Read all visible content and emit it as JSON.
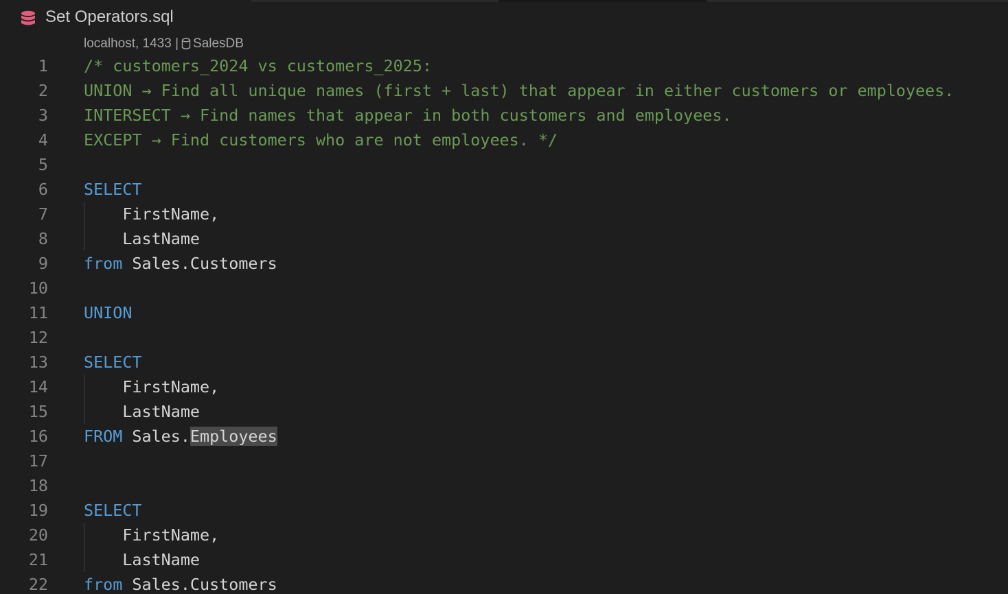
{
  "tab": {
    "title": "Set Operators.sql",
    "icon": "database-icon"
  },
  "connection": {
    "server": "localhost, 1433 |",
    "database": "SalesDB",
    "icon": "database-cylinder-icon"
  },
  "colors": {
    "background": "#1e1e1e",
    "comment": "#6a9955",
    "keyword": "#569cd6",
    "text": "#d4d4d4",
    "line_number": "#858585",
    "selection_highlight": "#4a4a4a",
    "db_icon": "#e05d7c"
  },
  "lines": [
    {
      "n": "1",
      "parts": [
        {
          "t": "/* customers_2024 vs customers_2025:",
          "c": "cmt"
        }
      ]
    },
    {
      "n": "2",
      "parts": [
        {
          "t": "UNION → Find all unique names (first + last) that appear in either customers or employees.",
          "c": "cmt"
        }
      ]
    },
    {
      "n": "3",
      "parts": [
        {
          "t": "INTERSECT → Find names that appear in both customers and employees.",
          "c": "cmt"
        }
      ]
    },
    {
      "n": "4",
      "parts": [
        {
          "t": "EXCEPT → Find customers who are not employees. */",
          "c": "cmt"
        }
      ]
    },
    {
      "n": "5",
      "parts": []
    },
    {
      "n": "6",
      "parts": [
        {
          "t": "SELECT",
          "c": "kw"
        }
      ]
    },
    {
      "n": "7",
      "parts": [
        {
          "t": "    FirstName,",
          "c": "plain"
        }
      ]
    },
    {
      "n": "8",
      "parts": [
        {
          "t": "    LastName",
          "c": "plain"
        }
      ]
    },
    {
      "n": "9",
      "parts": [
        {
          "t": "from",
          "c": "kw"
        },
        {
          "t": " Sales.Customers",
          "c": "plain"
        }
      ]
    },
    {
      "n": "10",
      "parts": []
    },
    {
      "n": "11",
      "parts": [
        {
          "t": "UNION",
          "c": "kw"
        }
      ]
    },
    {
      "n": "12",
      "parts": []
    },
    {
      "n": "13",
      "parts": [
        {
          "t": "SELECT",
          "c": "kw"
        }
      ]
    },
    {
      "n": "14",
      "parts": [
        {
          "t": "    FirstName,",
          "c": "plain"
        }
      ]
    },
    {
      "n": "15",
      "parts": [
        {
          "t": "    LastName",
          "c": "plain"
        }
      ]
    },
    {
      "n": "16",
      "parts": [
        {
          "t": "FROM",
          "c": "kw"
        },
        {
          "t": " Sales.",
          "c": "plain"
        },
        {
          "t": "Employees",
          "c": "plain hl"
        }
      ]
    },
    {
      "n": "17",
      "parts": []
    },
    {
      "n": "18",
      "parts": []
    },
    {
      "n": "19",
      "parts": [
        {
          "t": "SELECT",
          "c": "kw"
        }
      ]
    },
    {
      "n": "20",
      "parts": [
        {
          "t": "    FirstName,",
          "c": "plain"
        }
      ]
    },
    {
      "n": "21",
      "parts": [
        {
          "t": "    LastName",
          "c": "plain"
        }
      ]
    },
    {
      "n": "22",
      "parts": [
        {
          "t": "from",
          "c": "kw"
        },
        {
          "t": " Sales.Customers",
          "c": "plain"
        }
      ]
    }
  ]
}
